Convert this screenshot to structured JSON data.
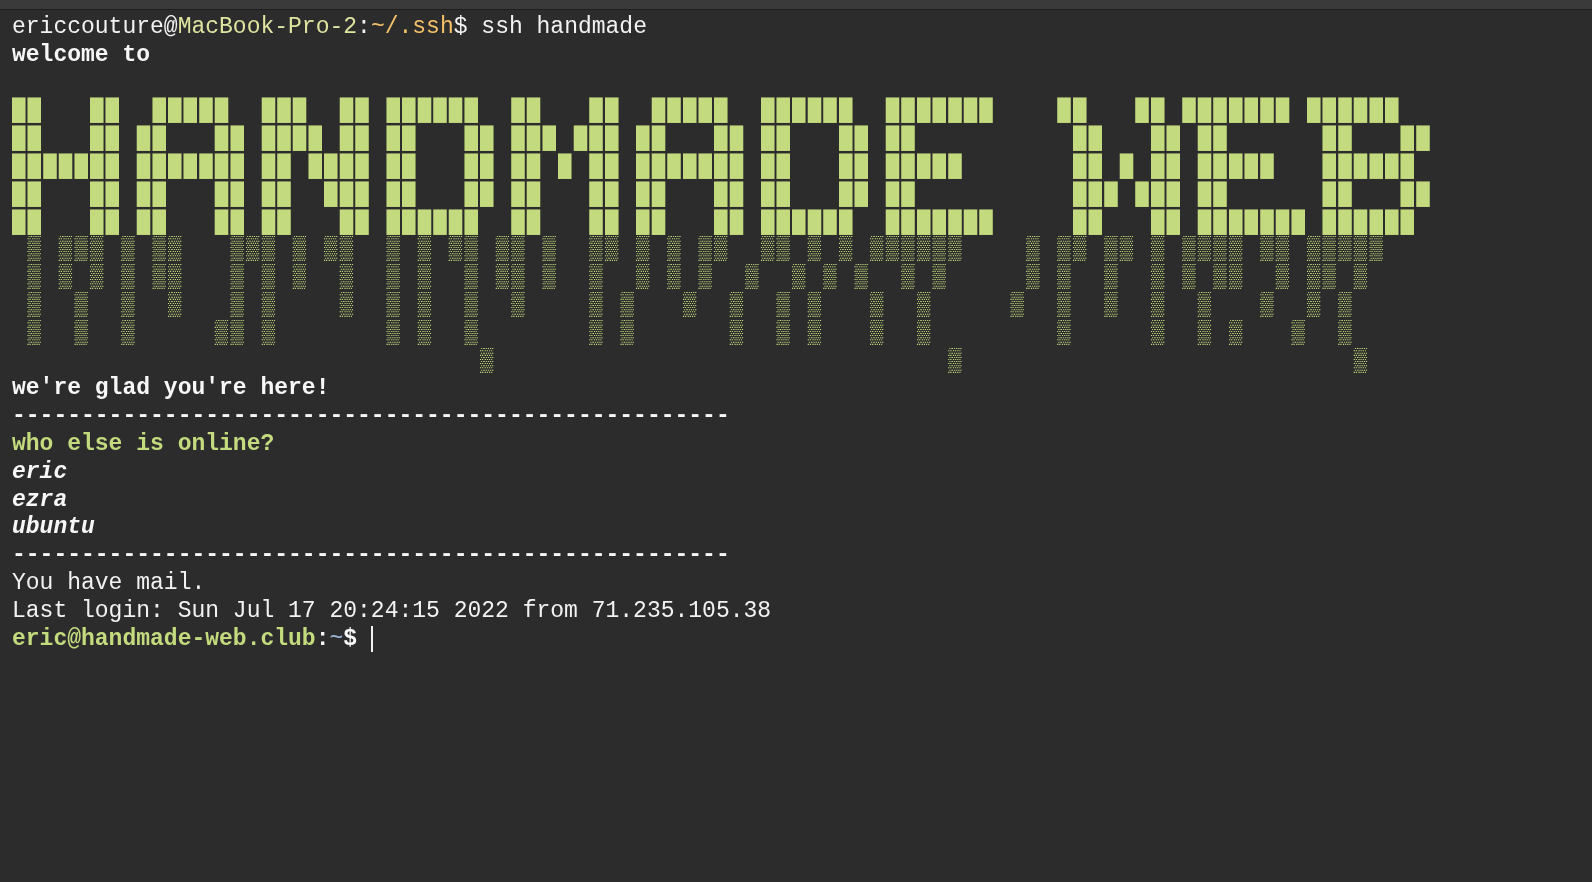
{
  "terminal": {
    "lines_before": [
      {
        "segments": [
          {
            "text": "ericcouture@",
            "kind": "plain"
          },
          {
            "text": "MacBook-Pro-2",
            "kind": "host"
          },
          {
            "text": ":",
            "kind": "plain"
          },
          {
            "text": "~/.ssh",
            "kind": "path"
          },
          {
            "text": "$ ssh handmade",
            "kind": "plain"
          }
        ]
      },
      {
        "segments": [
          {
            "text": "welcome to",
            "kind": "bold"
          }
        ]
      }
    ],
    "banner": {
      "lines": [
        "██   ██  █████  ███  ██ ██████  ██   ██  █████  ██████  ███████    ██   ██ ███████ ██████",
        "██   ██ ██   ██ ████ ██ ██   ██ ███ ███ ██   ██ ██   ██ ██          ██   ██ ██      ██   ██",
        "███████ ███████ ██ ████ ██   ██ ██ █ ██ ███████ ██   ██ █████       ██ █ ██ █████   ██████",
        "██   ██ ██   ██ ██  ███ ██   ██ ██   ██ ██   ██ ██   ██ ██          ███ ███ ██      ██   ██",
        "██   ██ ██   ██ ██   ██ ██████  ██   ██ ██   ██ ██████  ███████     ██   ██ ███████ ██████",
        " ▒ ▒▒▒ ▒ ▒▒   ▒▒▒ ▒ ▒▒  ▒ ▒ ▒▒ ▒▒ ▒  ▒▒ ▒ ▒ ▒▒  ▒▒ ▒ ▒ ▒▒▒▒▒▒    ▒ ▒▒ ▒▒ ▒ ▒▒▒▒ ▒▒ ▒▒▒▒▒",
        " ▒ ▒ ▒ ▒ ▒▒   ▒ ▒ ▒  ▒  ▒ ▒  ▒ ▒▒ ▒  ▒  ▒ ▒ ▒  ▒  ▒ ▒ ▒  ▒ ▒     ▒ ▒  ▒  ▒ ▒ ▒▒  ▒ ▒▒ ▒",
        " ▒  ▒  ▒  ▒   ▒ ▒    ▒  ▒ ▒  ▒  ▒    ▒ ▒   ▒  ▒  ▒ ▒   ▒  ▒     ▒  ▒  ▒  ▒  ▒   ▒  ▒ ▒",
        " ▒  ▒  ▒     ▒▒ ▒       ▒ ▒  ▒       ▒ ▒      ▒  ▒ ▒   ▒  ▒        ▒     ▒  ▒ ▒   ▒  ▒",
        "                              ▒                             ▒                         ▒"
      ]
    },
    "lines_after": [
      {
        "segments": [
          {
            "text": "we're glad you're here!",
            "kind": "bold"
          }
        ]
      },
      {
        "segments": [
          {
            "text": "----------------------------------------------------",
            "kind": "bold"
          }
        ]
      },
      {
        "segments": [
          {
            "text": "who else is online?",
            "kind": "heading"
          }
        ]
      },
      {
        "segments": [
          {
            "text": "eric",
            "kind": "user"
          }
        ]
      },
      {
        "segments": [
          {
            "text": "ezra",
            "kind": "user"
          }
        ]
      },
      {
        "segments": [
          {
            "text": "ubuntu",
            "kind": "user"
          }
        ]
      },
      {
        "segments": [
          {
            "text": "----------------------------------------------------",
            "kind": "bold"
          }
        ]
      },
      {
        "segments": [
          {
            "text": "You have mail.",
            "kind": "plain"
          }
        ]
      },
      {
        "segments": [
          {
            "text": "Last login: Sun Jul 17 20:24:15 2022 from 71.235.105.38",
            "kind": "plain"
          }
        ]
      }
    ],
    "prompt": {
      "segments": [
        {
          "text": "eric@handmade-web.club",
          "kind": "heading"
        },
        {
          "text": ":",
          "kind": "bold"
        },
        {
          "text": "~",
          "kind": "tilde"
        },
        {
          "text": "$",
          "kind": "bold"
        }
      ]
    }
  }
}
